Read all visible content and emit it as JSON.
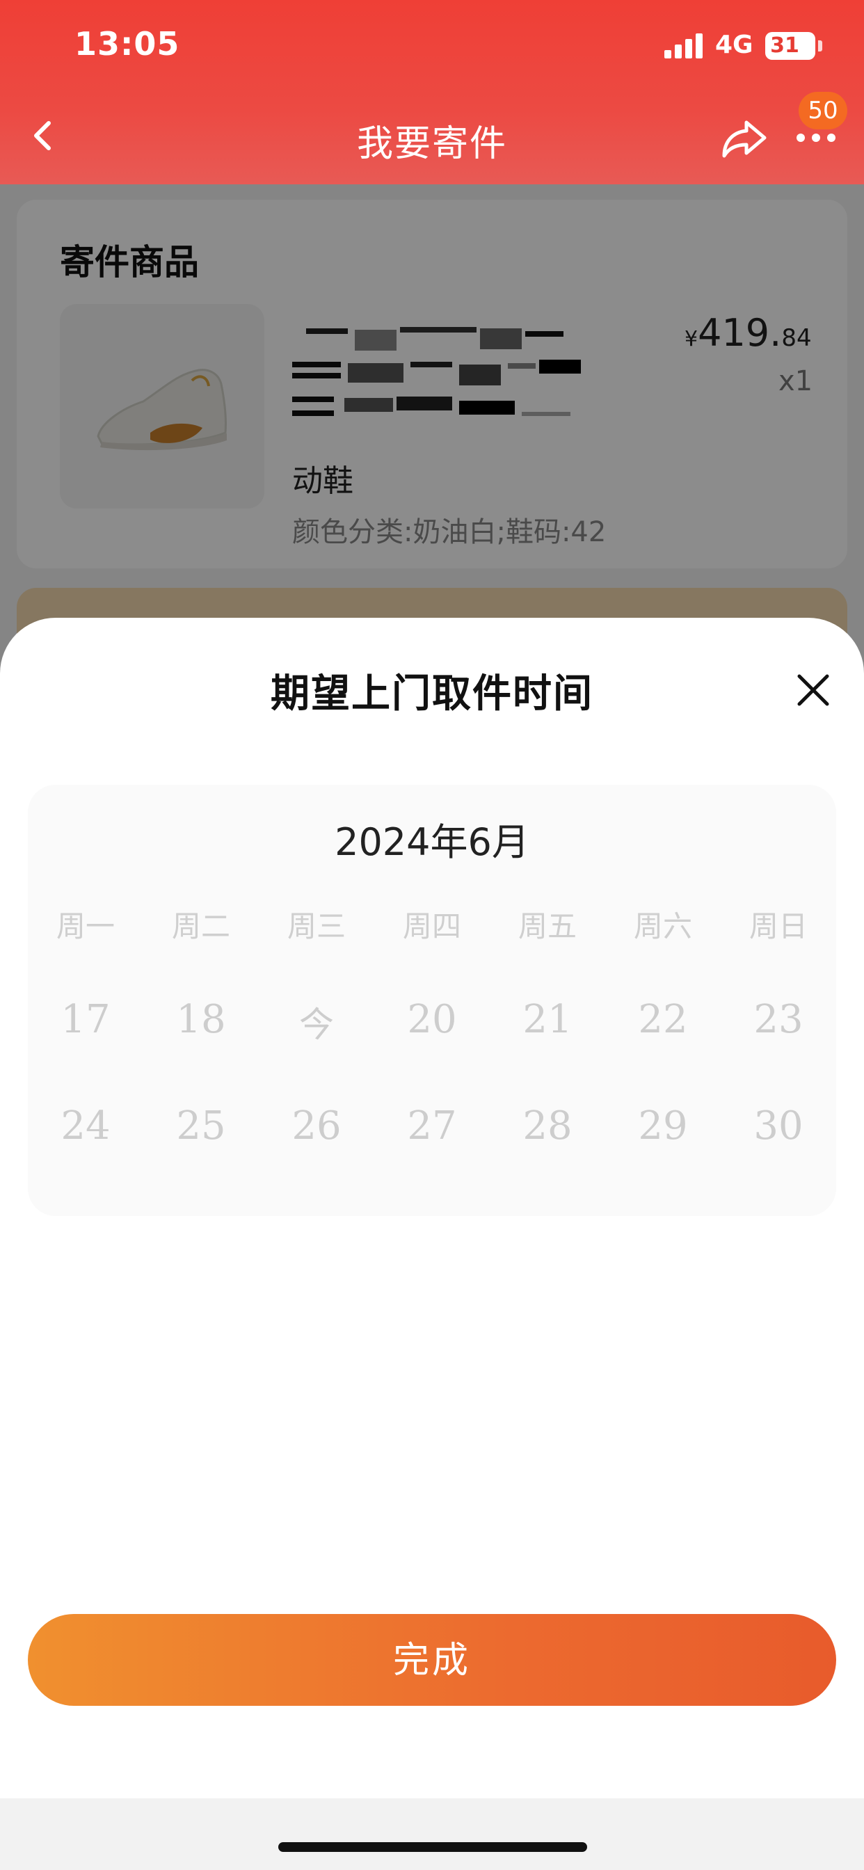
{
  "status_bar": {
    "time": "13:05",
    "network": "4G",
    "battery": "31"
  },
  "nav": {
    "title": "我要寄件",
    "badge": "50",
    "back_icon": "chevron-left-icon",
    "share_icon": "share-icon",
    "more_icon": "more-dots-icon"
  },
  "goods_card": {
    "title": "寄件商品",
    "product_name_tail": "动鞋",
    "spec": "颜色分类:奶油白;鞋码:42",
    "price_symbol": "¥",
    "price_int": "419.",
    "price_dec": "84",
    "qty": "x1"
  },
  "sheet": {
    "title": "期望上门取件时间",
    "close_icon": "close-icon"
  },
  "calendar": {
    "month": "2024年6月",
    "weekdays": [
      "周一",
      "周二",
      "周三",
      "周四",
      "周五",
      "周六",
      "周日"
    ],
    "rows": [
      [
        "17",
        "18",
        "今",
        "20",
        "21",
        "22",
        "23"
      ],
      [
        "24",
        "25",
        "26",
        "27",
        "28",
        "29",
        "30"
      ]
    ]
  },
  "done_button": "完成",
  "colors": {
    "header_red": "#ef3f36",
    "badge_orange": "#f46a22",
    "button_orange_start": "#f0902f",
    "button_orange_end": "#e85b2c"
  }
}
